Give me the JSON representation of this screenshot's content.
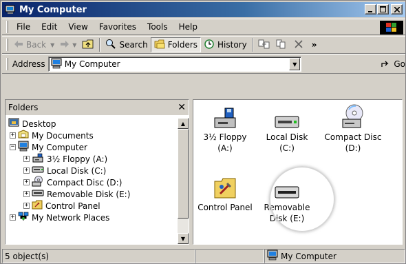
{
  "window": {
    "title": "My Computer"
  },
  "menubar": {
    "items": [
      "File",
      "Edit",
      "View",
      "Favorites",
      "Tools",
      "Help"
    ]
  },
  "toolbar": {
    "back": "Back",
    "search": "Search",
    "folders": "Folders",
    "history": "History"
  },
  "address": {
    "label": "Address",
    "value": "My Computer",
    "go": "Go"
  },
  "left_pane": {
    "header": "Folders",
    "tree": [
      {
        "label": "Desktop",
        "icon": "desktop-icon"
      },
      {
        "label": "My Documents",
        "icon": "folder-icon"
      },
      {
        "label": "My Computer",
        "icon": "computer-icon"
      },
      {
        "label": "3½ Floppy (A:)",
        "icon": "floppy-icon"
      },
      {
        "label": "Local Disk (C:)",
        "icon": "drive-icon"
      },
      {
        "label": "Compact Disc (D:)",
        "icon": "cd-icon"
      },
      {
        "label": "Removable Disk (E:)",
        "icon": "removable-disk-icon"
      },
      {
        "label": "Control Panel",
        "icon": "control-panel-icon"
      },
      {
        "label": "My Network Places",
        "icon": "network-icon"
      }
    ]
  },
  "right_pane": {
    "items": [
      {
        "label": "3½ Floppy (A:)",
        "icon": "floppy-icon"
      },
      {
        "label": "Local Disk (C:)",
        "icon": "drive-icon"
      },
      {
        "label": "Compact Disc (D:)",
        "icon": "cd-icon"
      },
      {
        "label": "Control Panel",
        "icon": "control-panel-icon"
      },
      {
        "label": "Removable Disk (E:)",
        "icon": "removable-disk-icon"
      }
    ]
  },
  "status": {
    "objects": "5 object(s)",
    "location": "My Computer"
  },
  "colors": {
    "titlebar_start": "#0a246a",
    "titlebar_end": "#a6caf0",
    "face": "#d4d0c8"
  }
}
